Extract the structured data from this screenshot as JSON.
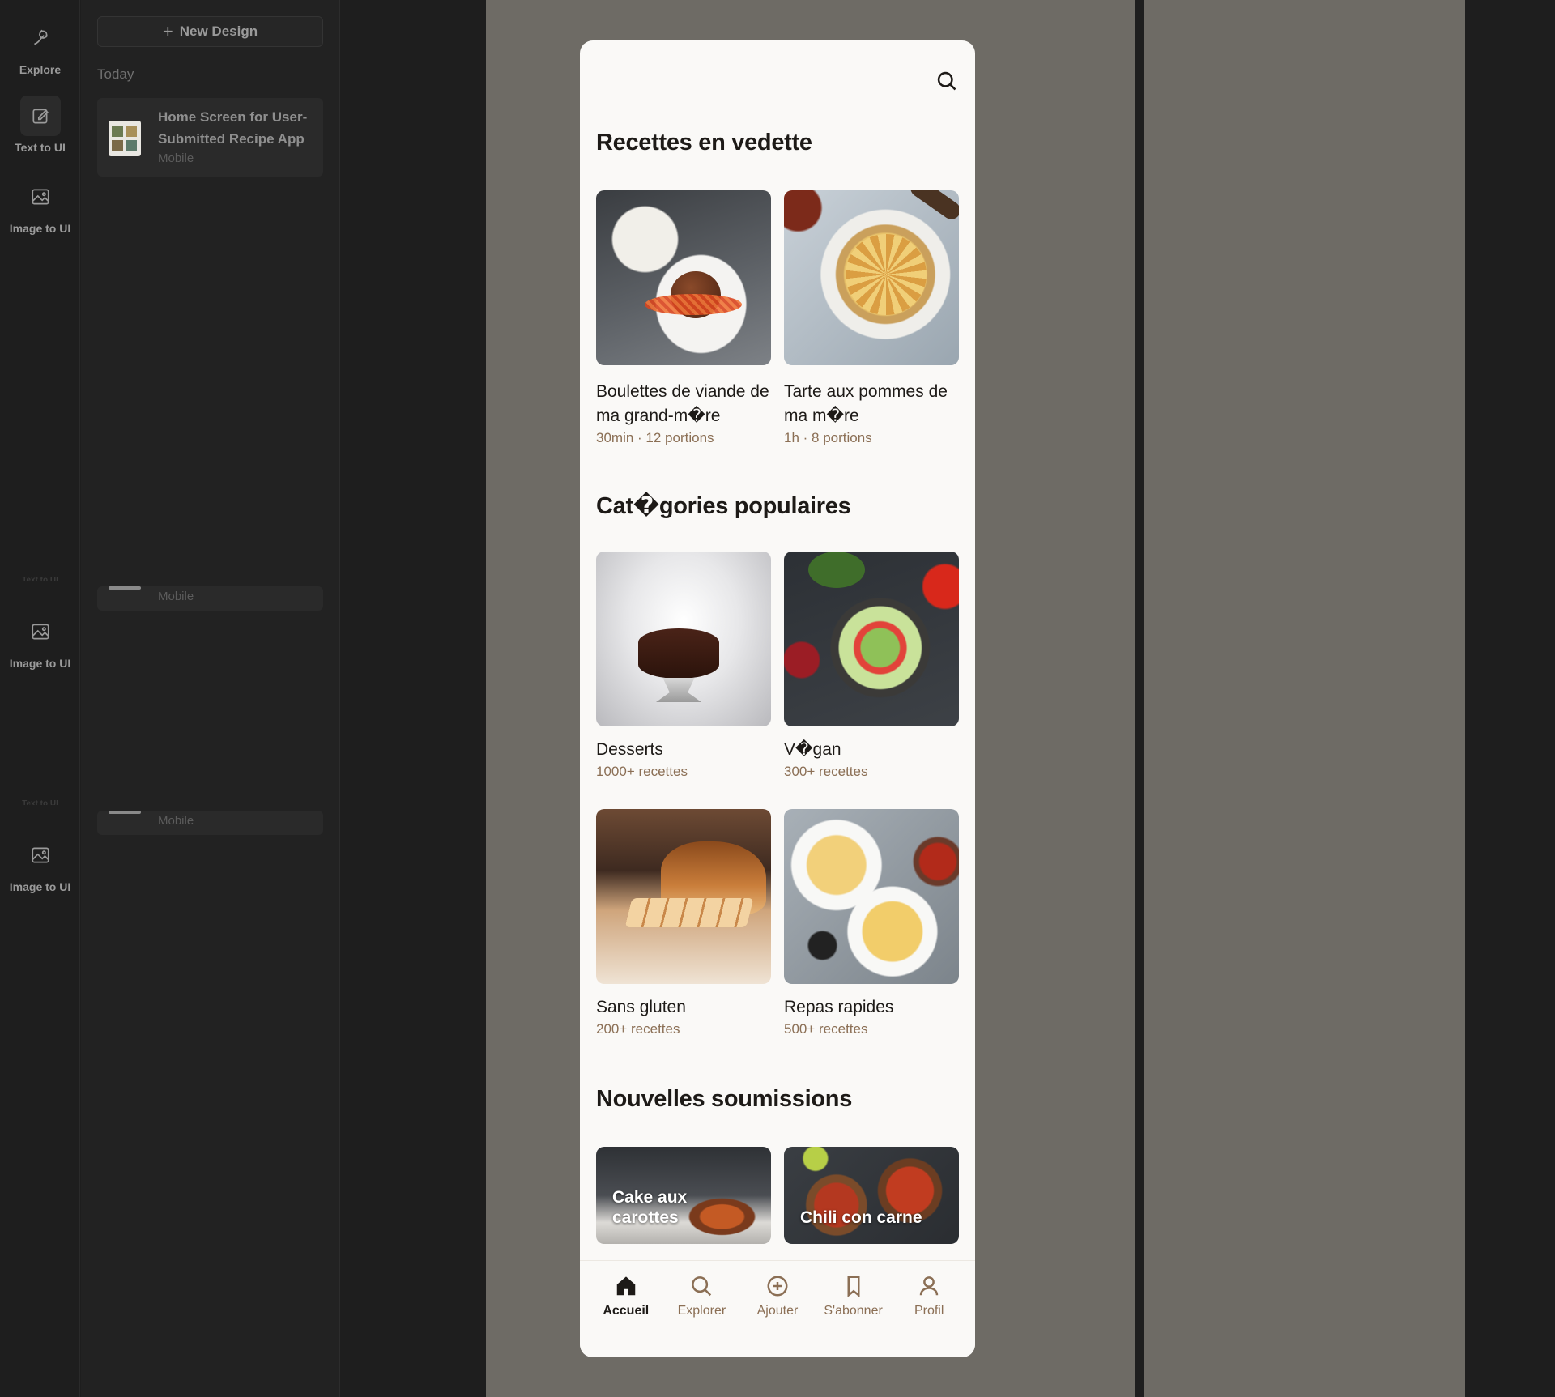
{
  "rail": {
    "explore": "Explore",
    "text_to_ui": "Text to UI",
    "image_to_ui": "Image to UI",
    "ghost_label": "Text to UI"
  },
  "history": {
    "new_design": "New Design",
    "section": "Today",
    "cards": [
      {
        "title": "Home Screen for User-Submitted Recipe App",
        "platform": "Mobile"
      },
      {
        "platform": "Mobile"
      },
      {
        "platform": "Mobile"
      }
    ]
  },
  "phone": {
    "featured": {
      "title": "Recettes en vedette",
      "items": [
        {
          "title": "Boulettes de viande de ma grand-m�re",
          "meta": "30min · 12 portions"
        },
        {
          "title": "Tarte aux pommes de ma m�re",
          "meta": "1h · 8 portions"
        }
      ]
    },
    "categories": {
      "title": "Cat�gories populaires",
      "items": [
        {
          "title": "Desserts",
          "meta": "1000+ recettes"
        },
        {
          "title": "V�gan",
          "meta": "300+ recettes"
        },
        {
          "title": "Sans gluten",
          "meta": "200+ recettes"
        },
        {
          "title": "Repas rapides",
          "meta": "500+ recettes"
        }
      ]
    },
    "submissions": {
      "title": "Nouvelles soumissions",
      "items": [
        {
          "title": "Cake aux carottes"
        },
        {
          "title": "Chili con carne"
        }
      ]
    },
    "tabs": [
      {
        "label": "Accueil",
        "icon": "home-icon",
        "active": true
      },
      {
        "label": "Explorer",
        "icon": "search-icon"
      },
      {
        "label": "Ajouter",
        "icon": "add-circle-icon"
      },
      {
        "label": "S'abonner",
        "icon": "bookmark-icon"
      },
      {
        "label": "Profil",
        "icon": "user-icon"
      }
    ]
  },
  "colors": {
    "app_bg": "#1e1e1e",
    "canvas_column": "#6e6b65",
    "phone_bg": "#faf9f7",
    "accent_brown": "#8b6f55",
    "text_dark": "#1d1a17"
  }
}
